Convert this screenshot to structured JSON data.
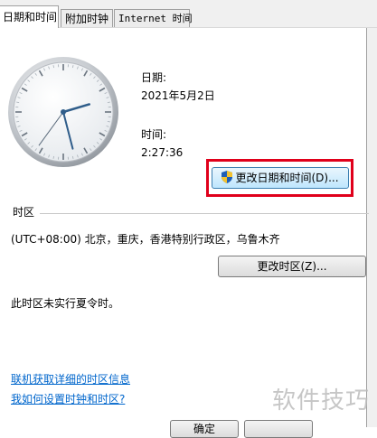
{
  "tabs": [
    {
      "label": "日期和时间",
      "active": true
    },
    {
      "label": "附加时钟",
      "active": false
    },
    {
      "label": "Internet 时间",
      "active": false
    }
  ],
  "date": {
    "label": "日期:",
    "value": "2021年5月2日"
  },
  "time": {
    "label": "时间:",
    "value": "2:27:36"
  },
  "clock": {
    "hour": 2,
    "minute": 27,
    "second": 36
  },
  "buttons": {
    "change_datetime": "更改日期和时间(D)...",
    "change_timezone": "更改时区(Z)...",
    "bottom_left": "确定"
  },
  "timezone": {
    "group_title": "时区",
    "current": "(UTC+08:00) 北京，重庆，香港特别行政区，乌鲁木齐",
    "dst_note": "此时区未实行夏令时。"
  },
  "links": {
    "online_info": "联机获取详细的时区信息",
    "how_to": "我如何设置时钟和时区?"
  },
  "watermark": "软件技巧",
  "colors": {
    "highlight": "#e0001b",
    "link": "#0066cc",
    "hand": "#2f5d8a"
  }
}
